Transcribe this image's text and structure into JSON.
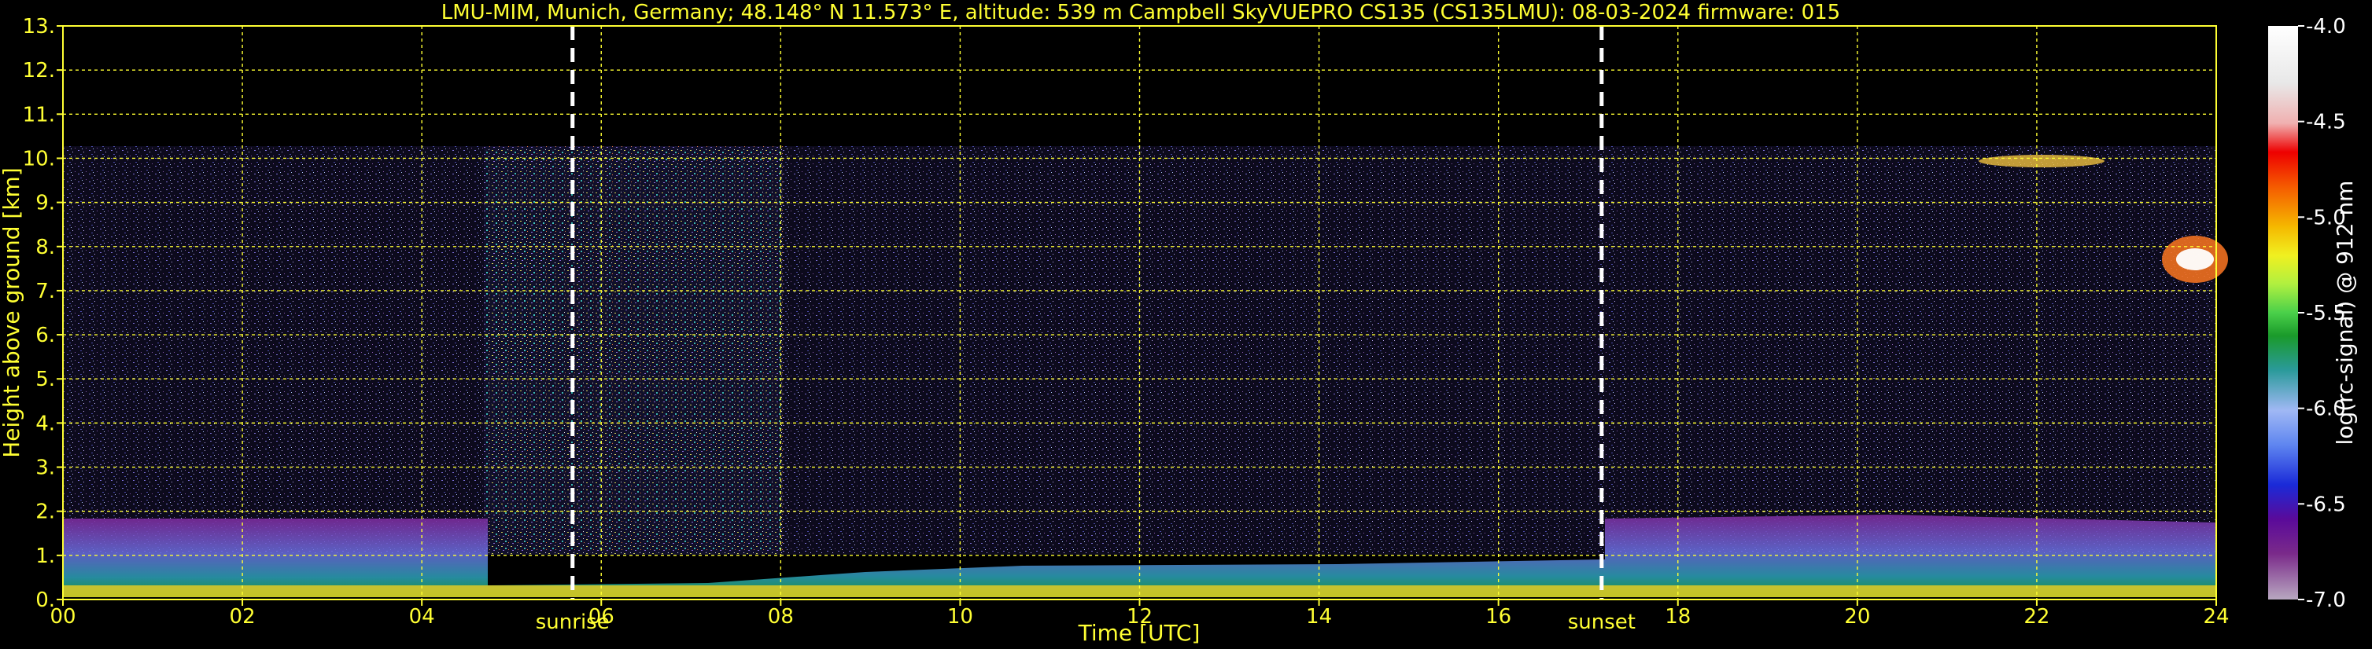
{
  "title": "LMU-MIM, Munich, Germany; 48.148° N 11.573° E, altitude: 539 m    Campbell SkyVUEPRO CS135 (CS135LMU): 08-03-2024    firmware: 015",
  "chart_data": {
    "type": "heatmap",
    "xlabel": "Time [UTC]",
    "ylabel": "Height above ground [km]",
    "xlim": [
      0,
      24
    ],
    "ylim": [
      0,
      13
    ],
    "x_ticks": [
      "00",
      "02",
      "04",
      "06",
      "08",
      "10",
      "12",
      "14",
      "16",
      "18",
      "20",
      "22",
      "24"
    ],
    "y_ticks": [
      "0.",
      "1.",
      "2.",
      "3.",
      "4.",
      "5.",
      "6.",
      "7.",
      "8.",
      "9.",
      "10.",
      "11.",
      "12.",
      "13."
    ],
    "grid": true,
    "annotations": [
      {
        "label": "sunrise",
        "x": 5.68
      },
      {
        "label": "sunset",
        "x": 17.15
      }
    ],
    "colorbar": {
      "label": "log(rc-signal) @ 912 nm",
      "range": [
        -7.0,
        -4.0
      ],
      "ticks": [
        "-4.0",
        "-4.5",
        "-5.0",
        "-5.5",
        "-6.0",
        "-6.5",
        "-7.0"
      ]
    },
    "colors": {
      "axis": "#ffff33",
      "background": "#000000",
      "annotation_line": "#ffffff"
    }
  }
}
